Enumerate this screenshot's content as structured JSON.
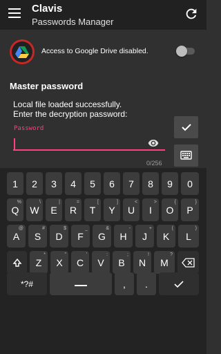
{
  "header": {
    "title": "Clavis",
    "subtitle": "Passwords Manager"
  },
  "drive": {
    "label": "Access to Google Drive disabled.",
    "enabled": false
  },
  "master": {
    "title": "Master password",
    "message_line1": "Local file loaded successfully.",
    "message_line2": "Enter the decryption password:",
    "field_label": "Password",
    "field_value": "",
    "counter": "0/256"
  },
  "colors": {
    "accent": "#ff4081",
    "appbar": "#212121",
    "background": "#303030",
    "keyboard": "#232323"
  },
  "keyboard": {
    "row1": [
      "1",
      "2",
      "3",
      "4",
      "5",
      "6",
      "7",
      "8",
      "9",
      "0"
    ],
    "row2": [
      "Q",
      "W",
      "E",
      "R",
      "T",
      "Y",
      "U",
      "I",
      "O",
      "P"
    ],
    "row2_hints": [
      "%",
      "\\",
      "|",
      "=",
      "[",
      "]",
      "<",
      ">",
      "{",
      "}"
    ],
    "row3": [
      "A",
      "S",
      "D",
      "F",
      "G",
      "H",
      "J",
      "K",
      "L"
    ],
    "row3_hints": [
      "@",
      "#",
      "$",
      "_",
      "&",
      "-",
      "+",
      "(",
      ")"
    ],
    "row4": [
      "Z",
      "X",
      "C",
      "V",
      "B",
      "N",
      "M"
    ],
    "row4_hints": [
      "*",
      "\"",
      "'",
      ":",
      ";",
      "!",
      "?"
    ],
    "symbols_label": "*?#",
    "comma": ",",
    "period": ".",
    "shift_icon": "shift-icon",
    "backspace_icon": "backspace-icon",
    "enter_icon": "checkmark-icon"
  }
}
